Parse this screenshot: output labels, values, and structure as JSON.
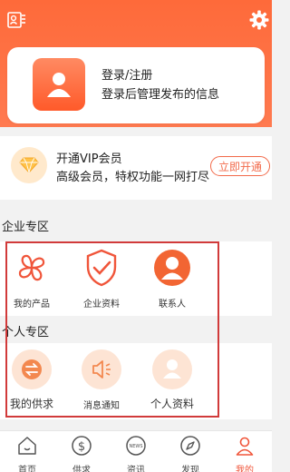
{
  "header": {
    "bg_color": "#fe6a3a"
  },
  "login": {
    "title": "登录/注册",
    "subtitle": "登录后管理发布的信息"
  },
  "vip": {
    "title": "开通VIP会员",
    "subtitle": "高级会员，特权功能一网打尽",
    "button": "立即开通"
  },
  "enterprise": {
    "title": "企业专区",
    "items": [
      {
        "label": "我的产品",
        "icon": "clover-icon"
      },
      {
        "label": "企业资料",
        "icon": "shield-check-icon"
      },
      {
        "label": "联系人",
        "icon": "person-circle-icon"
      }
    ]
  },
  "personal": {
    "title": "个人专区",
    "items": [
      {
        "label": "我的供求",
        "icon": "exchange-icon"
      },
      {
        "label": "消息通知",
        "icon": "speaker-icon"
      },
      {
        "label": "个人资料",
        "icon": "profile-icon"
      }
    ]
  },
  "tabbar": {
    "items": [
      {
        "label": "首页",
        "icon": "home-icon"
      },
      {
        "label": "供求",
        "icon": "dollar-icon"
      },
      {
        "label": "资讯",
        "icon": "news-icon",
        "badge": "NEWS"
      },
      {
        "label": "发现",
        "icon": "compass-icon"
      },
      {
        "label": "我的",
        "icon": "user-icon"
      }
    ],
    "active": "我的",
    "active_color": "#f0553a"
  }
}
